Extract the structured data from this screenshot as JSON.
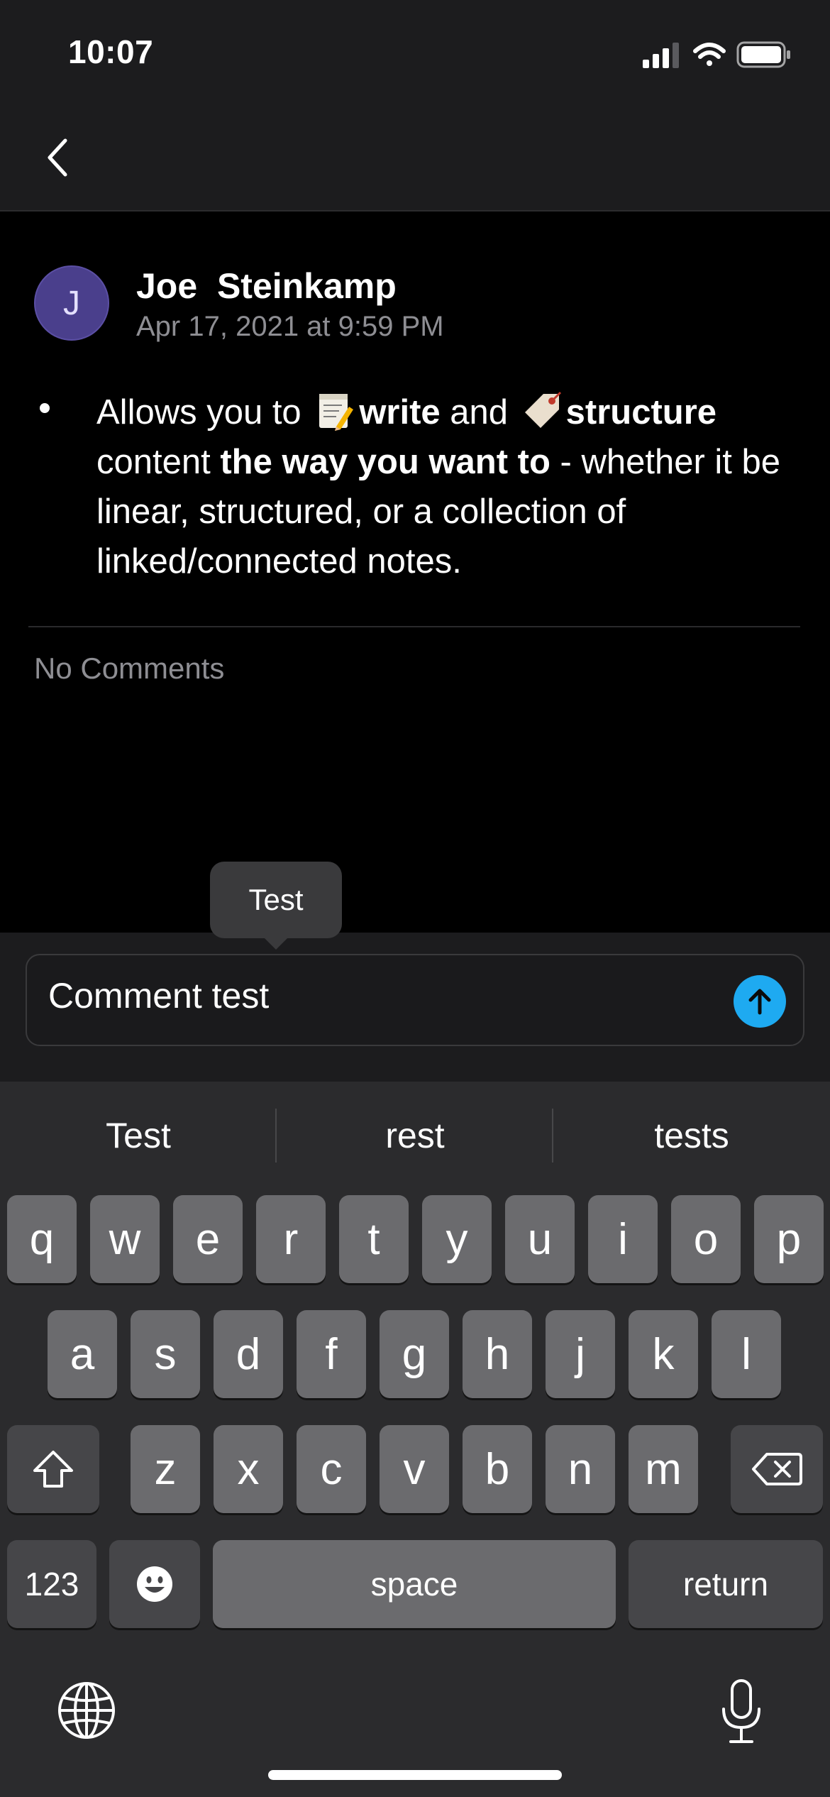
{
  "status_bar": {
    "time": "10:07"
  },
  "post": {
    "author_initial": "J",
    "author_name": "Joe  Steinkamp",
    "timestamp": "Apr 17, 2021 at 9:59 PM",
    "body": {
      "t1": "Allows you to ",
      "b1": "write",
      "t2": " and ",
      "b2": "structure",
      "t3": " content ",
      "b3": "the way you want to",
      "t4": " - whether it be linear, structured, or a collection of linked/connected notes."
    }
  },
  "comments": {
    "empty_label": "No Comments"
  },
  "tooltip": {
    "text": "Test"
  },
  "comment_input": {
    "value": "Comment test"
  },
  "keyboard": {
    "suggestions": [
      "Test",
      "rest",
      "tests"
    ],
    "row1": [
      "q",
      "w",
      "e",
      "r",
      "t",
      "y",
      "u",
      "i",
      "o",
      "p"
    ],
    "row2": [
      "a",
      "s",
      "d",
      "f",
      "g",
      "h",
      "j",
      "k",
      "l"
    ],
    "row3": [
      "z",
      "x",
      "c",
      "v",
      "b",
      "n",
      "m"
    ],
    "numbers_label": "123",
    "space_label": "space",
    "return_label": "return"
  },
  "colors": {
    "accent": "#1eaaf1",
    "avatar": "#4a3f8c"
  }
}
